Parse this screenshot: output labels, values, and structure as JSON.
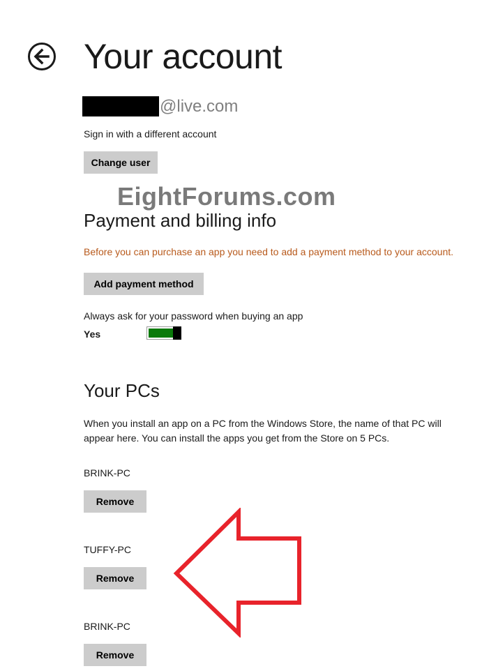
{
  "header": {
    "title": "Your account",
    "back_icon": "back-arrow-icon"
  },
  "account": {
    "email_domain": "@live.com",
    "switch_prompt": "Sign in with a different account",
    "change_user_label": "Change user"
  },
  "watermark": "EightForums.com",
  "payment": {
    "heading": "Payment and billing info",
    "warning": "Before you can purchase an app you need to add a payment method to your account.",
    "add_payment_label": "Add payment method",
    "password_prompt": "Always ask for your password when buying an app",
    "toggle_state": "Yes",
    "toggle_on": true
  },
  "pcs": {
    "heading": "Your PCs",
    "description": "When you install an app on a PC from the Windows Store, the name of that PC will appear here. You can install the apps you get from the Store on 5 PCs.",
    "remove_label": "Remove",
    "list": [
      {
        "name": "BRINK-PC"
      },
      {
        "name": "TUFFY-PC"
      },
      {
        "name": "BRINK-PC"
      }
    ]
  },
  "colors": {
    "warning": "#b85a1c",
    "toggle_on": "#0b7a0b",
    "button_bg": "#cccccc",
    "annotation_arrow": "#e8232b"
  }
}
